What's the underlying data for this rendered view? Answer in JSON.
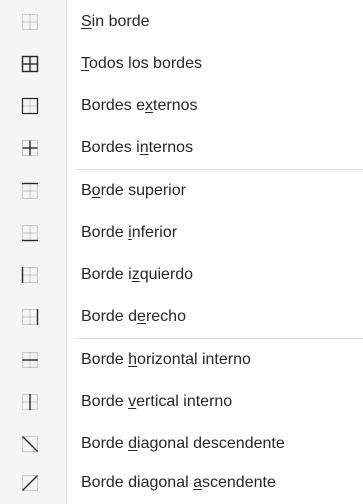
{
  "menu": {
    "items": [
      {
        "id": "sin-borde",
        "pre": "",
        "acc": "S",
        "post": "in borde",
        "icon": "no-border-icon"
      },
      {
        "id": "todos-los-bordes",
        "pre": "",
        "acc": "T",
        "post": "odos los bordes",
        "icon": "all-borders-icon"
      },
      {
        "id": "bordes-externos",
        "pre": "Bordes e",
        "acc": "x",
        "post": "ternos",
        "icon": "outside-borders-icon"
      },
      {
        "id": "bordes-internos",
        "pre": "Bordes i",
        "acc": "n",
        "post": "ternos",
        "icon": "inside-borders-icon"
      },
      {
        "id": "borde-superior",
        "pre": "B",
        "acc": "o",
        "post": "rde superior",
        "icon": "top-border-icon"
      },
      {
        "id": "borde-inferior",
        "pre": "Borde ",
        "acc": "i",
        "post": "nferior",
        "icon": "bottom-border-icon"
      },
      {
        "id": "borde-izquierdo",
        "pre": "Borde i",
        "acc": "z",
        "post": "quierdo",
        "icon": "left-border-icon"
      },
      {
        "id": "borde-derecho",
        "pre": "Borde d",
        "acc": "e",
        "post": "recho",
        "icon": "right-border-icon"
      },
      {
        "id": "borde-horizontal-interno",
        "pre": "Borde ",
        "acc": "h",
        "post": "orizontal interno",
        "icon": "inside-horizontal-border-icon"
      },
      {
        "id": "borde-vertical-interno",
        "pre": "Borde ",
        "acc": "v",
        "post": "ertical interno",
        "icon": "inside-vertical-border-icon"
      },
      {
        "id": "borde-diagonal-descendente",
        "pre": "Borde ",
        "acc": "d",
        "post": "iagonal descendente",
        "icon": "diagonal-down-border-icon"
      },
      {
        "id": "borde-diagonal-ascendente",
        "pre": "Borde diagonal ",
        "acc": "a",
        "post": "scendente",
        "icon": "diagonal-up-border-icon"
      }
    ]
  },
  "colors": {
    "text": "#262626",
    "icon_solid": "#262626",
    "icon_dotted": "#9a9a9a",
    "gutter": "#f5f5f5"
  }
}
